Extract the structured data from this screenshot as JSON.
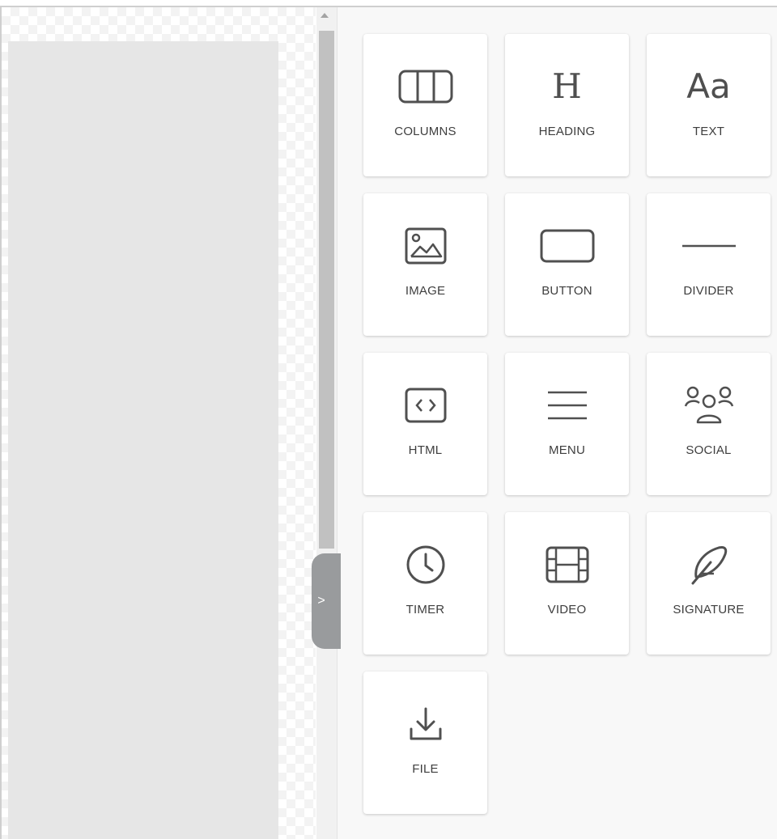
{
  "panel": {
    "tiles": [
      {
        "label": "COLUMNS",
        "icon": "columns-icon"
      },
      {
        "label": "HEADING",
        "icon": "heading-icon",
        "glyph": "H"
      },
      {
        "label": "TEXT",
        "icon": "text-icon",
        "glyph": "Aa"
      },
      {
        "label": "IMAGE",
        "icon": "image-icon"
      },
      {
        "label": "BUTTON",
        "icon": "button-icon"
      },
      {
        "label": "DIVIDER",
        "icon": "divider-icon"
      },
      {
        "label": "HTML",
        "icon": "html-icon"
      },
      {
        "label": "MENU",
        "icon": "menu-icon"
      },
      {
        "label": "SOCIAL",
        "icon": "social-icon"
      },
      {
        "label": "TIMER",
        "icon": "timer-icon"
      },
      {
        "label": "VIDEO",
        "icon": "video-icon"
      },
      {
        "label": "SIGNATURE",
        "icon": "signature-icon"
      },
      {
        "label": "FILE",
        "icon": "file-download-icon"
      }
    ]
  },
  "collapse_tab": {
    "glyph": ">"
  },
  "colors": {
    "panel_bg": "#f8f8f8",
    "tile_bg": "#ffffff",
    "icon": "#505050",
    "tab": "#999b9d"
  }
}
